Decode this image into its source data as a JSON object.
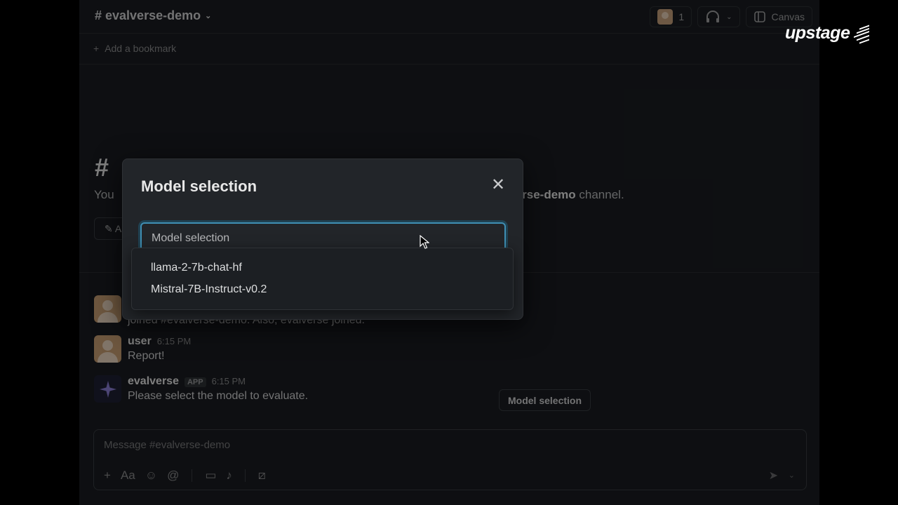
{
  "header": {
    "channel": "# evalverse-demo",
    "member_count": "1",
    "canvas_label": "Canvas"
  },
  "bookmark_bar": {
    "add_bookmark": "Add a bookmark"
  },
  "intro": {
    "hash": "#",
    "text_prefix": "You",
    "channel_bold": "erse-demo",
    "text_suffix": " channel.",
    "button_label": "A"
  },
  "messages": [
    {
      "name": "",
      "time": "",
      "text": "joined #evalverse-demo. Also, evalverse joined."
    },
    {
      "name": "user",
      "time": "6:15 PM",
      "text": "Report!"
    },
    {
      "name": "evalverse",
      "tag": "APP",
      "time": "6:15 PM",
      "text": "Please select the model to evaluate."
    }
  ],
  "model_button_label": "Model selection",
  "composer": {
    "placeholder": "Message #evalverse-demo"
  },
  "logo": "upstage",
  "modal": {
    "title": "Model selection",
    "select_placeholder": "Model selection",
    "options": [
      "llama-2-7b-chat-hf",
      "Mistral-7B-Instruct-v0.2"
    ]
  }
}
